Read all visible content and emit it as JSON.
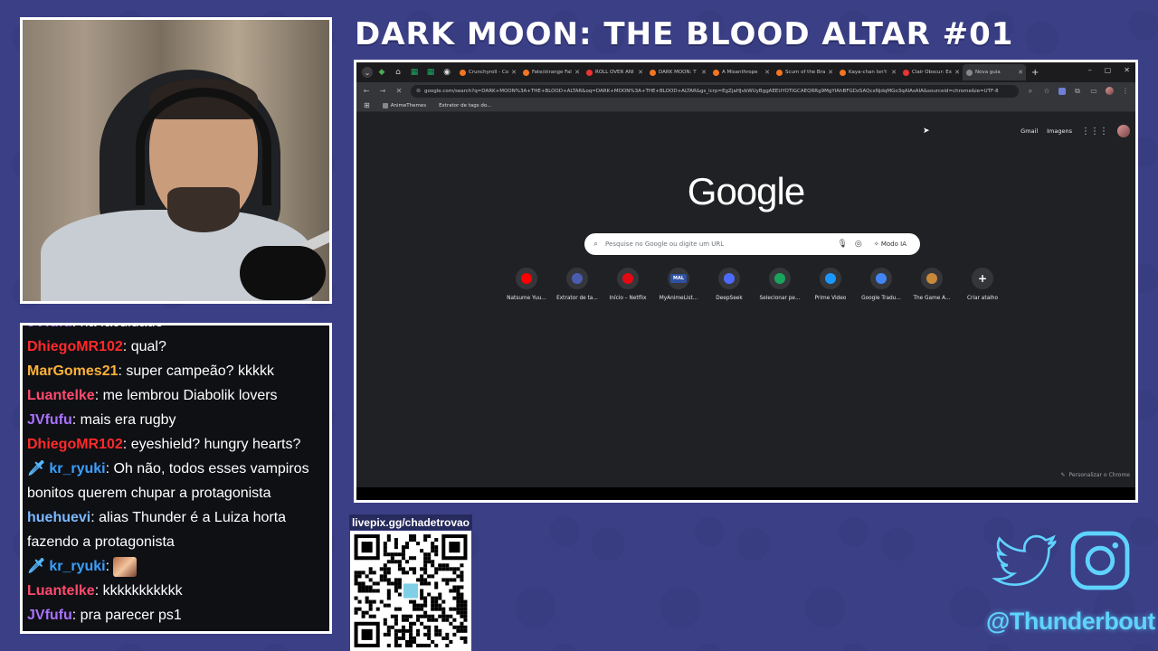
{
  "stream": {
    "title": "DARK MOON: THE BLOOD ALTAR #01"
  },
  "chat": {
    "messages": [
      {
        "user": "JVfufu",
        "text": "na faculdade",
        "color": "#a971ff"
      },
      {
        "user": "DhiegoMR102",
        "text": "qual?",
        "color": "#ff2a2a"
      },
      {
        "user": "MarGomes21",
        "text": "super campeão? kkkkk",
        "color": "#ffb23a"
      },
      {
        "user": "Luantelke",
        "text": "me lembrou Diabolik lovers",
        "color": "#ff4a6e"
      },
      {
        "user": "JVfufu",
        "text": "mais era rugby",
        "color": "#a971ff"
      },
      {
        "user": "DhiegoMR102",
        "text": "eyeshield? hungry hearts?",
        "color": "#ff2a2a"
      },
      {
        "user": "kr_ryuki",
        "text": "Oh não, todos esses vampiros bonitos querem chupar a protagonista",
        "color": "#3aa0ff",
        "badge": true
      },
      {
        "user": "huehuevi",
        "text": "alias Thunder é a Luiza horta fazendo a protagonista",
        "color": "#7ab8ff"
      },
      {
        "user": "kr_ryuki",
        "text": "",
        "color": "#3aa0ff",
        "badge": true,
        "emote": true
      },
      {
        "user": "Luantelke",
        "text": "kkkkkkkkkkk",
        "color": "#ff4a6e"
      },
      {
        "user": "JVfufu",
        "text": "pra parecer ps1",
        "color": "#a971ff"
      }
    ]
  },
  "browser": {
    "tabs": [
      {
        "label": "Crunchyroll - Co",
        "color": "#f47521"
      },
      {
        "label": "Fate/strange Fal",
        "color": "#f47521"
      },
      {
        "label": "ROLL OVER ANI",
        "color": "#e33"
      },
      {
        "label": "DARK MOON: T",
        "color": "#f47521"
      },
      {
        "label": "A Misanthrope",
        "color": "#f47521"
      },
      {
        "label": "Scum of the Bra",
        "color": "#f47521"
      },
      {
        "label": "Kaya-chan Isn't",
        "color": "#f47521"
      },
      {
        "label": "Clair Obscur: Ex",
        "color": "#e33"
      },
      {
        "label": "Nova guia",
        "color": "#888",
        "active": true
      }
    ],
    "url": "google.com/search?q=DARK+MOON%3A+THE+BLOOD+ALTAR&oq=DARK+MOON%3A+THE+BLOOD+ALTAR&gs_lcrp=EgZjaHJvbWUyBggAEEUYOTIGCAEQRRg9MgYIAhBFGDzSAQcxNjdqMGo3qAIAsAIA&sourceid=chrome&ie=UTF-8",
    "bookmarks": [
      {
        "label": "AnimeThemes"
      },
      {
        "label": "Extrator de tags do..."
      }
    ],
    "top_links": {
      "gmail": "Gmail",
      "images": "Imagens"
    },
    "logo": "Google",
    "search_placeholder": "Pesquise no Google ou digite um URL",
    "ai_mode": "Modo IA",
    "shortcuts": [
      {
        "label": "Natsume Yuu...",
        "icon": "youtube-icon",
        "color": "#ff0000"
      },
      {
        "label": "Extrator de ta...",
        "icon": "extractor-icon",
        "color": "#4a5cb0"
      },
      {
        "label": "Início – Netflix",
        "icon": "netflix-icon",
        "color": "#e50914"
      },
      {
        "label": "MyAnimeList...",
        "icon": "mal-icon",
        "color": "#2e51a2",
        "text": "MAL"
      },
      {
        "label": "DeepSeek",
        "icon": "deepseek-icon",
        "color": "#4d6bfe"
      },
      {
        "label": "Selecionar pe...",
        "icon": "select-icon",
        "color": "#1aa35b"
      },
      {
        "label": "Prime Video",
        "icon": "prime-video-icon",
        "color": "#1a98ff"
      },
      {
        "label": "Google Tradu...",
        "icon": "translate-icon",
        "color": "#4285f4"
      },
      {
        "label": "The Game A...",
        "icon": "game-awards-icon",
        "color": "#c8893a"
      },
      {
        "label": "Criar atalho",
        "icon": "plus-icon",
        "color": "#35363a",
        "text": "+"
      }
    ],
    "customize": "Personalizar o Chrome"
  },
  "livepix": {
    "label": "livepix.gg/chadetrovao"
  },
  "social": {
    "handle": "@Thunderbout"
  }
}
